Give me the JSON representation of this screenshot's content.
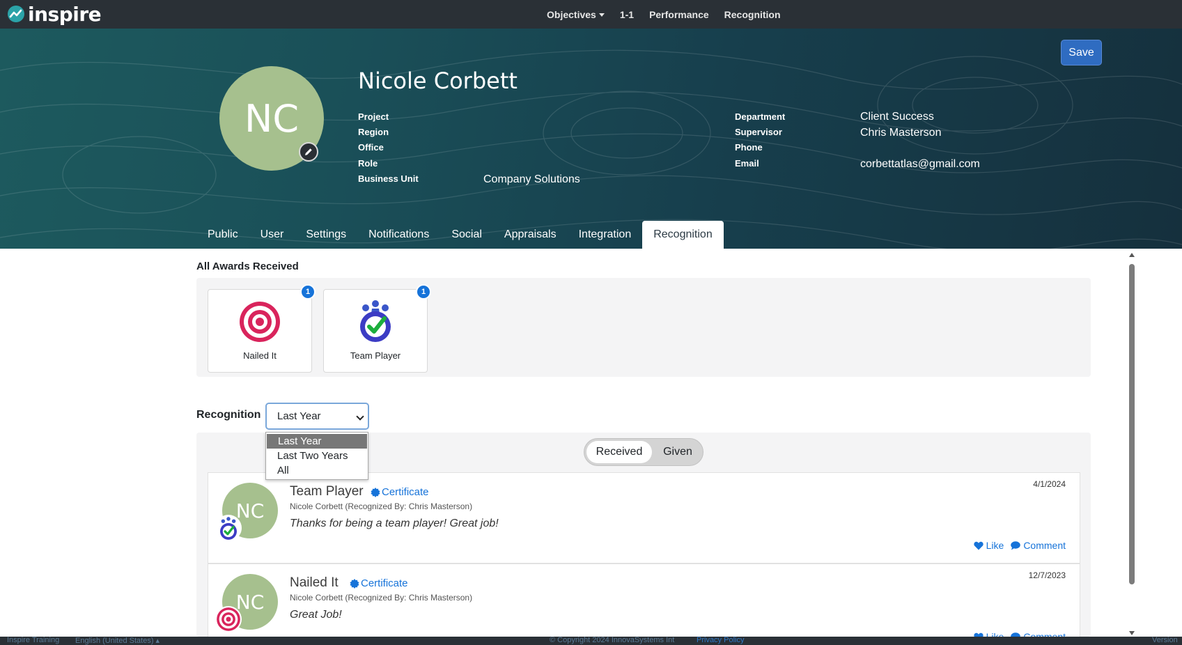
{
  "app": {
    "logo_text": "inspire"
  },
  "nav": {
    "items": [
      "Objectives",
      "1-1",
      "Performance",
      "Recognition"
    ]
  },
  "header": {
    "save_label": "Save",
    "initials": "NC",
    "name": "Nicole Corbett",
    "left_fields": [
      {
        "label": "Project",
        "value": ""
      },
      {
        "label": "Region",
        "value": ""
      },
      {
        "label": "Office",
        "value": ""
      },
      {
        "label": "Role",
        "value": ""
      },
      {
        "label": "Business Unit",
        "value": "Company Solutions"
      }
    ],
    "right_fields": [
      {
        "label": "Department",
        "value": "Client Success"
      },
      {
        "label": "Supervisor",
        "value": "Chris Masterson"
      },
      {
        "label": "Phone",
        "value": ""
      },
      {
        "label": "Email",
        "value": "corbettatlas@gmail.com"
      }
    ]
  },
  "tabs": [
    "Public",
    "User",
    "Settings",
    "Notifications",
    "Social",
    "Appraisals",
    "Integration",
    "Recognition"
  ],
  "active_tab": "Recognition",
  "awards": {
    "title": "All Awards Received",
    "items": [
      {
        "label": "Nailed It",
        "count": "1",
        "icon": "target-icon"
      },
      {
        "label": "Team Player",
        "count": "1",
        "icon": "team-check-icon"
      }
    ]
  },
  "recognition": {
    "label": "Recognition",
    "selected": "Last Year",
    "options": [
      "Last Year",
      "Last Two Years",
      "All"
    ],
    "toggle": {
      "received": "Received",
      "given": "Given"
    },
    "entries": [
      {
        "title": "Team Player",
        "certificate": "Certificate",
        "subtitle": "Nicole Corbett (Recognized By: Chris Masterson)",
        "message": "Thanks for being a team player! Great job!",
        "date": "4/1/2024",
        "like": "Like",
        "comment": "Comment",
        "initials": "NC"
      },
      {
        "title": "Nailed It",
        "certificate": "Certificate",
        "subtitle": "Nicole Corbett (Recognized By: Chris Masterson)",
        "message": "Great Job!",
        "date": "12/7/2023",
        "like": "Like",
        "comment": "Comment",
        "initials": "NC"
      }
    ]
  },
  "footer": {
    "left": "Inspire Training",
    "lang": "English (United States) ▴",
    "copyright": "© Copyright 2024 InnovaSystems Int",
    "privacy": "Privacy Policy",
    "version": "Version"
  },
  "colors": {
    "accent": "#1673d9",
    "avatar": "#a6c08e",
    "topbar": "#2a3036",
    "hero": "#1a4f58"
  }
}
